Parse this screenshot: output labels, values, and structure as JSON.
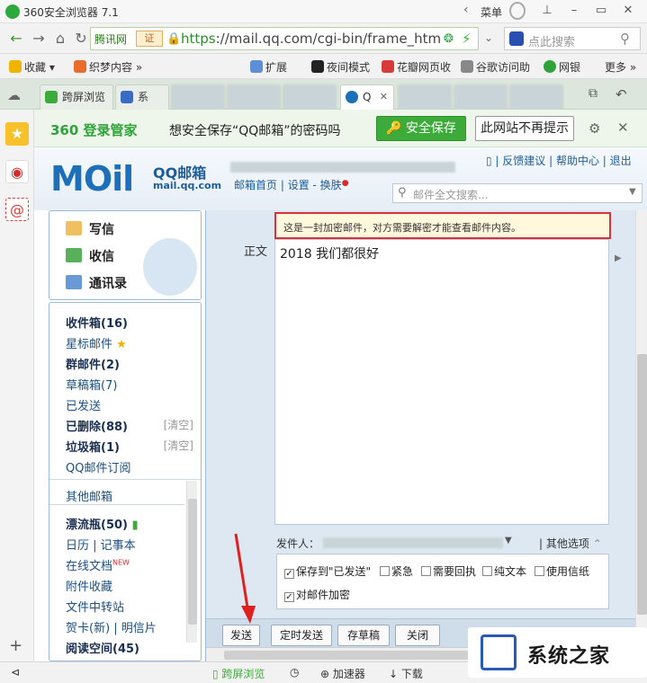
{
  "browser": {
    "title": "360安全浏览器 7.1",
    "menu_label": "菜单",
    "address": {
      "site_name": "腾讯网",
      "cert_label": "证",
      "url_scheme": "https",
      "url_rest": "://mail.qq.com/cgi-bin/frame_htm",
      "search_placeholder": "点此搜索"
    },
    "bookmarks": [
      {
        "label": "收藏",
        "icon": "star-icon"
      },
      {
        "label": "织梦内容",
        "icon": "bookmark-icon"
      },
      {
        "label": "扩展",
        "icon": "grid-icon"
      },
      {
        "label": "夜间模式",
        "icon": "moon-icon"
      },
      {
        "label": "花瓣网页收",
        "icon": "petal-icon"
      },
      {
        "label": "谷歌访问助",
        "icon": "google-icon"
      },
      {
        "label": "网银",
        "icon": "bank-icon"
      },
      {
        "label": "更多",
        "icon": "more-icon"
      }
    ],
    "tabs": [
      {
        "label": "跨屏浏览"
      },
      {
        "label": "系"
      },
      {
        "label": "Q"
      }
    ],
    "statusbar": {
      "cross_screen": "跨屏浏览",
      "accelerator": "加速器",
      "download": "下载"
    }
  },
  "savebar": {
    "brand": "360 登录管家",
    "prompt": "想安全保存“QQ邮箱”的密码吗",
    "save_button": "安全保存",
    "never_button": "此网站不再提示"
  },
  "mail": {
    "logo": {
      "main": "MOil",
      "name": "QQ邮箱",
      "domain": "mail.qq.com"
    },
    "toplinks": {
      "feedback": "反馈建议",
      "help": "帮助中心",
      "logout": "退出"
    },
    "subnav": {
      "home": "邮箱首页",
      "settings": "设置",
      "skin": "换肤"
    },
    "search_placeholder": "邮件全文搜索...",
    "nav": [
      {
        "label": "写信",
        "icon": "pencil-icon"
      },
      {
        "label": "收信",
        "icon": "inbox-icon"
      },
      {
        "label": "通讯录",
        "icon": "contacts-icon"
      }
    ],
    "folders": [
      {
        "label": "收件箱(16)",
        "bold": true
      },
      {
        "label": "星标邮件",
        "star": true
      },
      {
        "label": "群邮件(2)",
        "bold": true
      },
      {
        "label": "草稿箱(7)"
      },
      {
        "label": "已发送"
      },
      {
        "label": "已删除(88)",
        "bold": true,
        "clear": "[清空]"
      },
      {
        "label": "垃圾箱(1)",
        "bold": true,
        "clear": "[清空]"
      },
      {
        "label": "QQ邮件订阅"
      }
    ],
    "other_folders": [
      {
        "label": "其他邮箱"
      },
      {
        "label": "漂流瓶(50)",
        "bold": true
      },
      {
        "label": "日历 | 记事本"
      },
      {
        "label": "在线文档",
        "badge": "NEW"
      },
      {
        "label": "附件收藏"
      },
      {
        "label": "文件中转站"
      },
      {
        "label": "贺卡(新) | 明信片"
      },
      {
        "label": "阅读空间(45)",
        "bold": true
      }
    ],
    "compose": {
      "warning": "这是一封加密邮件，对方需要解密才能查看邮件内容。",
      "body_label": "正文",
      "body_text": "2018 我们都很好",
      "sender_label": "发件人：",
      "other_options": "其他选项",
      "options": [
        {
          "label": "保存到\"已发送\"",
          "checked": true
        },
        {
          "label": "紧急",
          "checked": false
        },
        {
          "label": "需要回执",
          "checked": false
        },
        {
          "label": "纯文本",
          "checked": false
        },
        {
          "label": "使用信纸",
          "checked": false
        },
        {
          "label": "对邮件加密",
          "checked": true
        }
      ],
      "buttons": {
        "send": "发送",
        "schedule": "定时发送",
        "draft": "存草稿",
        "close": "关闭"
      }
    }
  },
  "watermark": {
    "text": "系统之家"
  },
  "colors": {
    "brand_green": "#3dab3a",
    "mail_blue": "#1d6fb8",
    "warning_border": "#d9323a"
  }
}
